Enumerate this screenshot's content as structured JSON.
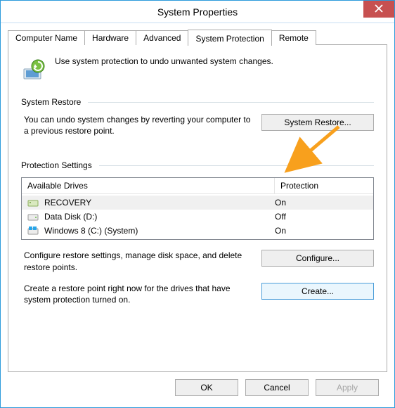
{
  "window": {
    "title": "System Properties"
  },
  "tabs": [
    {
      "label": "Computer Name",
      "active": false
    },
    {
      "label": "Hardware",
      "active": false
    },
    {
      "label": "Advanced",
      "active": false
    },
    {
      "label": "System Protection",
      "active": true
    },
    {
      "label": "Remote",
      "active": false
    }
  ],
  "intro_text": "Use system protection to undo unwanted system changes.",
  "groups": {
    "restore": {
      "title": "System Restore",
      "text": "You can undo system changes by reverting your computer to a previous restore point.",
      "button": "System Restore..."
    },
    "protection": {
      "title": "Protection Settings",
      "header_drive": "Available Drives",
      "header_prot": "Protection",
      "drives": [
        {
          "icon": "drive-icon",
          "name": "RECOVERY",
          "protection": "On",
          "selected": true
        },
        {
          "icon": "disk-icon",
          "name": "Data Disk (D:)",
          "protection": "Off",
          "selected": false
        },
        {
          "icon": "windows-disk-icon",
          "name": "Windows 8 (C:) (System)",
          "protection": "On",
          "selected": false
        }
      ],
      "configure_text": "Configure restore settings, manage disk space, and delete restore points.",
      "configure_label": "Configure...",
      "create_text": "Create a restore point right now for the drives that have system protection turned on.",
      "create_label": "Create..."
    }
  },
  "dialog_buttons": {
    "ok": "OK",
    "cancel": "Cancel",
    "apply": "Apply"
  }
}
